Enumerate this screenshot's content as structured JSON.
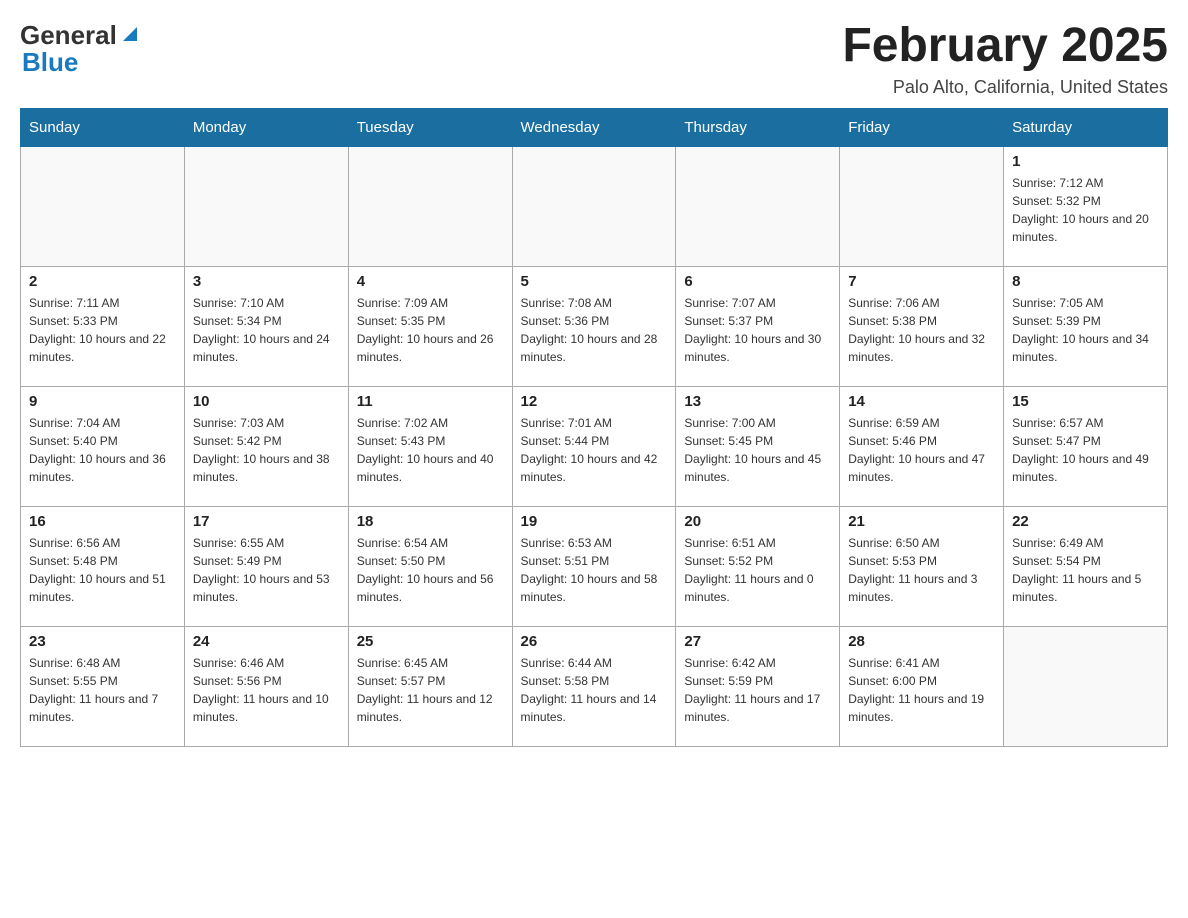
{
  "header": {
    "logo": {
      "general": "General",
      "triangle_char": "▲",
      "blue": "Blue"
    },
    "title": "February 2025",
    "location": "Palo Alto, California, United States"
  },
  "days_of_week": [
    "Sunday",
    "Monday",
    "Tuesday",
    "Wednesday",
    "Thursday",
    "Friday",
    "Saturday"
  ],
  "weeks": [
    [
      {
        "day": "",
        "info": ""
      },
      {
        "day": "",
        "info": ""
      },
      {
        "day": "",
        "info": ""
      },
      {
        "day": "",
        "info": ""
      },
      {
        "day": "",
        "info": ""
      },
      {
        "day": "",
        "info": ""
      },
      {
        "day": "1",
        "info": "Sunrise: 7:12 AM\nSunset: 5:32 PM\nDaylight: 10 hours and 20 minutes."
      }
    ],
    [
      {
        "day": "2",
        "info": "Sunrise: 7:11 AM\nSunset: 5:33 PM\nDaylight: 10 hours and 22 minutes."
      },
      {
        "day": "3",
        "info": "Sunrise: 7:10 AM\nSunset: 5:34 PM\nDaylight: 10 hours and 24 minutes."
      },
      {
        "day": "4",
        "info": "Sunrise: 7:09 AM\nSunset: 5:35 PM\nDaylight: 10 hours and 26 minutes."
      },
      {
        "day": "5",
        "info": "Sunrise: 7:08 AM\nSunset: 5:36 PM\nDaylight: 10 hours and 28 minutes."
      },
      {
        "day": "6",
        "info": "Sunrise: 7:07 AM\nSunset: 5:37 PM\nDaylight: 10 hours and 30 minutes."
      },
      {
        "day": "7",
        "info": "Sunrise: 7:06 AM\nSunset: 5:38 PM\nDaylight: 10 hours and 32 minutes."
      },
      {
        "day": "8",
        "info": "Sunrise: 7:05 AM\nSunset: 5:39 PM\nDaylight: 10 hours and 34 minutes."
      }
    ],
    [
      {
        "day": "9",
        "info": "Sunrise: 7:04 AM\nSunset: 5:40 PM\nDaylight: 10 hours and 36 minutes."
      },
      {
        "day": "10",
        "info": "Sunrise: 7:03 AM\nSunset: 5:42 PM\nDaylight: 10 hours and 38 minutes."
      },
      {
        "day": "11",
        "info": "Sunrise: 7:02 AM\nSunset: 5:43 PM\nDaylight: 10 hours and 40 minutes."
      },
      {
        "day": "12",
        "info": "Sunrise: 7:01 AM\nSunset: 5:44 PM\nDaylight: 10 hours and 42 minutes."
      },
      {
        "day": "13",
        "info": "Sunrise: 7:00 AM\nSunset: 5:45 PM\nDaylight: 10 hours and 45 minutes."
      },
      {
        "day": "14",
        "info": "Sunrise: 6:59 AM\nSunset: 5:46 PM\nDaylight: 10 hours and 47 minutes."
      },
      {
        "day": "15",
        "info": "Sunrise: 6:57 AM\nSunset: 5:47 PM\nDaylight: 10 hours and 49 minutes."
      }
    ],
    [
      {
        "day": "16",
        "info": "Sunrise: 6:56 AM\nSunset: 5:48 PM\nDaylight: 10 hours and 51 minutes."
      },
      {
        "day": "17",
        "info": "Sunrise: 6:55 AM\nSunset: 5:49 PM\nDaylight: 10 hours and 53 minutes."
      },
      {
        "day": "18",
        "info": "Sunrise: 6:54 AM\nSunset: 5:50 PM\nDaylight: 10 hours and 56 minutes."
      },
      {
        "day": "19",
        "info": "Sunrise: 6:53 AM\nSunset: 5:51 PM\nDaylight: 10 hours and 58 minutes."
      },
      {
        "day": "20",
        "info": "Sunrise: 6:51 AM\nSunset: 5:52 PM\nDaylight: 11 hours and 0 minutes."
      },
      {
        "day": "21",
        "info": "Sunrise: 6:50 AM\nSunset: 5:53 PM\nDaylight: 11 hours and 3 minutes."
      },
      {
        "day": "22",
        "info": "Sunrise: 6:49 AM\nSunset: 5:54 PM\nDaylight: 11 hours and 5 minutes."
      }
    ],
    [
      {
        "day": "23",
        "info": "Sunrise: 6:48 AM\nSunset: 5:55 PM\nDaylight: 11 hours and 7 minutes."
      },
      {
        "day": "24",
        "info": "Sunrise: 6:46 AM\nSunset: 5:56 PM\nDaylight: 11 hours and 10 minutes."
      },
      {
        "day": "25",
        "info": "Sunrise: 6:45 AM\nSunset: 5:57 PM\nDaylight: 11 hours and 12 minutes."
      },
      {
        "day": "26",
        "info": "Sunrise: 6:44 AM\nSunset: 5:58 PM\nDaylight: 11 hours and 14 minutes."
      },
      {
        "day": "27",
        "info": "Sunrise: 6:42 AM\nSunset: 5:59 PM\nDaylight: 11 hours and 17 minutes."
      },
      {
        "day": "28",
        "info": "Sunrise: 6:41 AM\nSunset: 6:00 PM\nDaylight: 11 hours and 19 minutes."
      },
      {
        "day": "",
        "info": ""
      }
    ]
  ]
}
